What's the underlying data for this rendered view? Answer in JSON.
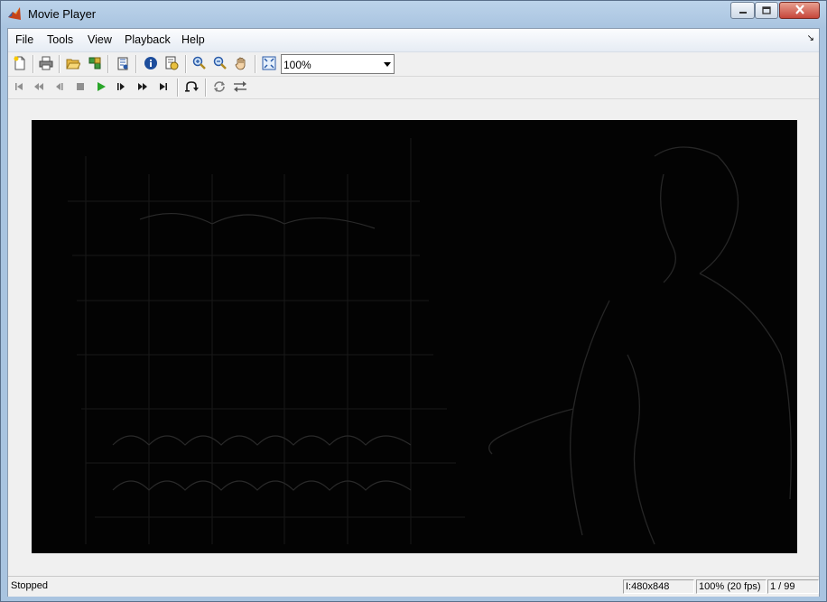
{
  "window": {
    "title": "Movie Player"
  },
  "menu": [
    {
      "label": "File"
    },
    {
      "label": "Tools"
    },
    {
      "label": "View"
    },
    {
      "label": "Playback"
    },
    {
      "label": "Help"
    }
  ],
  "toolbar1": {
    "icons": [
      "new-icon",
      "print-icon",
      "open-folder-icon",
      "connect-icon",
      "export-icon",
      "info-icon",
      "properties-icon",
      "zoom-in-icon",
      "zoom-out-icon",
      "pan-hand-icon",
      "fit-to-window-icon"
    ],
    "zoom": {
      "value": "100%"
    }
  },
  "toolbar2": {
    "icons": [
      "go-to-first-icon",
      "rewind-icon",
      "step-back-icon",
      "stop-icon",
      "play-icon",
      "step-forward-icon",
      "fast-forward-icon",
      "go-to-last-icon",
      "jump-to-icon",
      "autoreverse-icon",
      "toggle-direction-icon"
    ]
  },
  "colors": {
    "play_green": "#2aa62a",
    "video_bg": "#030303",
    "titlebar": "#a9c4e0"
  },
  "status": {
    "state": "Stopped",
    "frame_size": "I:480x848",
    "rate": "100% (20 fps)",
    "frame": "1 / 99"
  }
}
